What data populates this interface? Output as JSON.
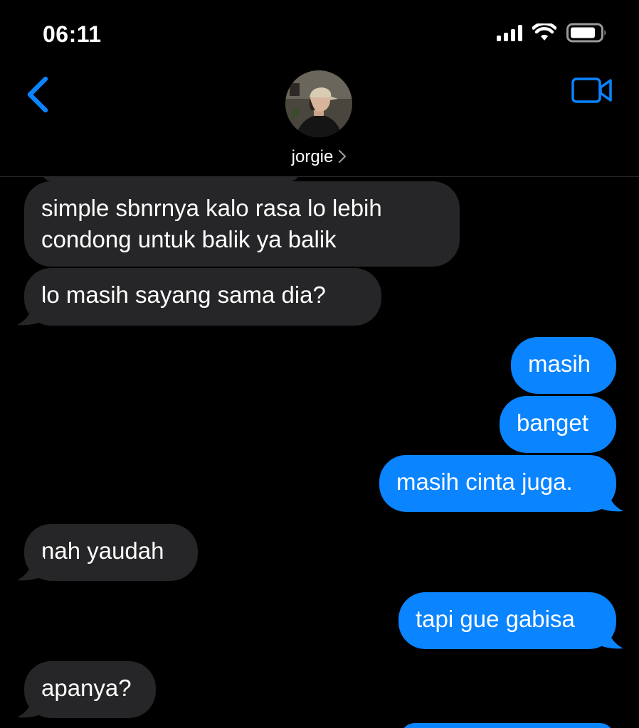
{
  "status_bar": {
    "time": "06:11",
    "icons": [
      "cellular-signal-icon",
      "wifi-icon",
      "battery-icon"
    ]
  },
  "header": {
    "contact_name": "jorgie",
    "icons": [
      "chevron-left-icon",
      "video-camera-icon",
      "chevron-right-icon"
    ],
    "accent_color": "#0a84ff"
  },
  "messages": [
    {
      "from": "them",
      "text_lines": [
        "simple sbnrnya kalo rasa lo lebih",
        "condong untuk balik ya balik"
      ]
    },
    {
      "from": "them",
      "text": "lo masih sayang sama dia?"
    },
    {
      "from": "me",
      "text": "masih"
    },
    {
      "from": "me",
      "text": "banget"
    },
    {
      "from": "me",
      "text": "masih cinta juga."
    },
    {
      "from": "them",
      "text": "nah yaudah"
    },
    {
      "from": "me",
      "text": "tapi gue gabisa"
    },
    {
      "from": "them",
      "text": "apanya?"
    }
  ],
  "colors": {
    "background": "#000000",
    "incoming_bubble": "#262628",
    "outgoing_bubble": "#0a84ff"
  }
}
